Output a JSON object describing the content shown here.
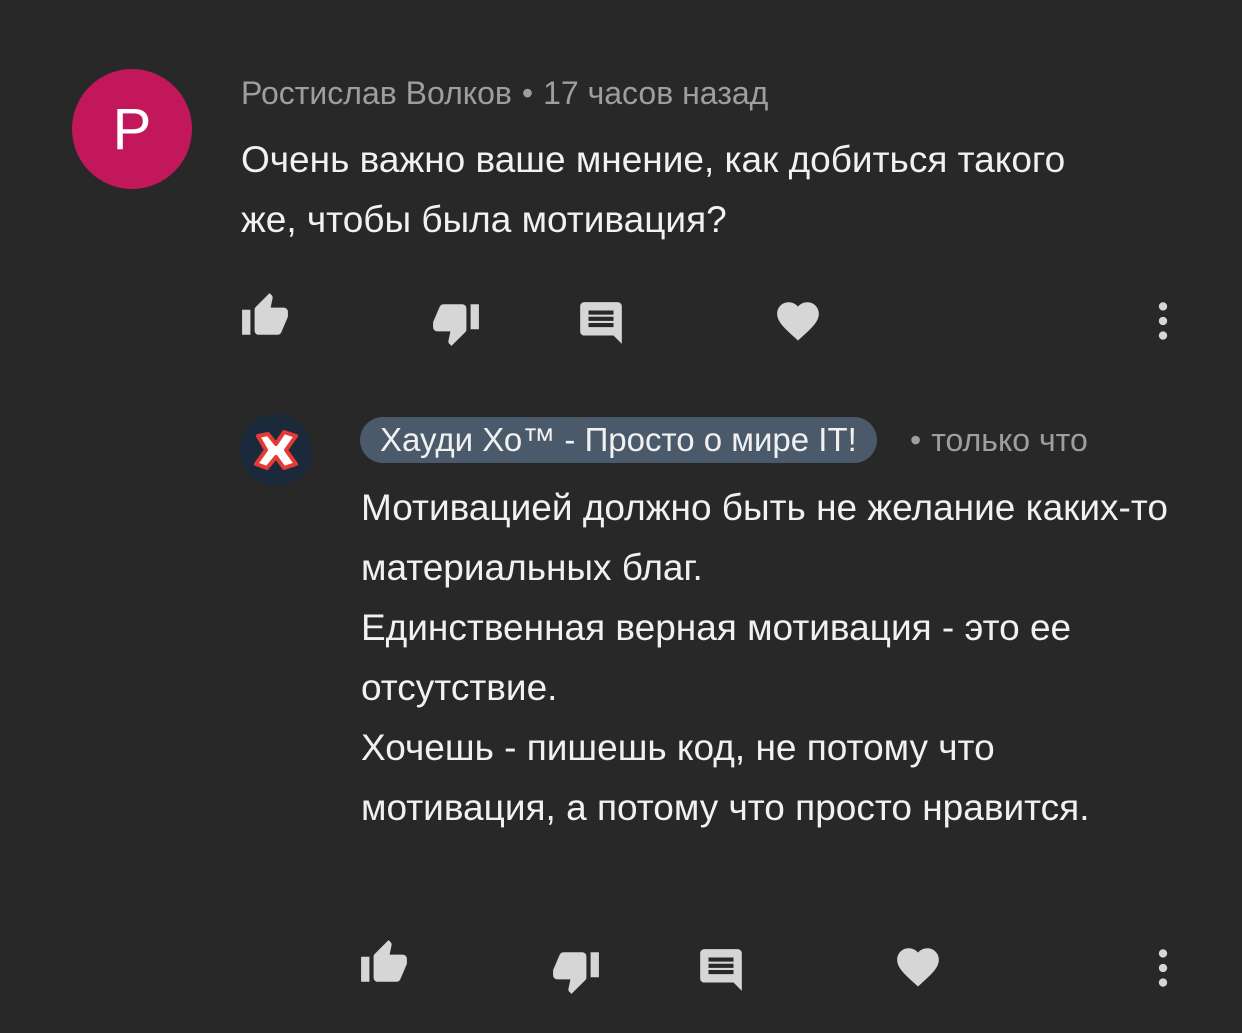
{
  "comment": {
    "avatar_letter": "Р",
    "author": "Ростислав Волков",
    "separator": "•",
    "time": "17 часов назад",
    "text": "Очень важно ваше мнение, как добиться такого же, чтобы была мотивация?"
  },
  "reply": {
    "author": "Хауди Хо™ - Просто о мире IT!",
    "separator": "•",
    "time": "только что",
    "lines": [
      "Мотивацией должно быть не желание каких-то материальных благ.",
      "Единственная верная мотивация - это ее отсутствие.",
      "Хочешь - пишешь код, не потому что мотивация, а потому что просто нравится."
    ]
  },
  "icons": {
    "like": "thumb-up-icon",
    "dislike": "thumb-down-icon",
    "reply": "comment-icon",
    "heart": "heart-icon",
    "more": "more-vertical-icon"
  },
  "colors": {
    "background": "#282828",
    "avatar_main": "#c2185b",
    "chip": "#4a5a6b",
    "icon": "#d6d6d6",
    "meta": "#9e9e9e",
    "text": "#f1f1f1"
  }
}
